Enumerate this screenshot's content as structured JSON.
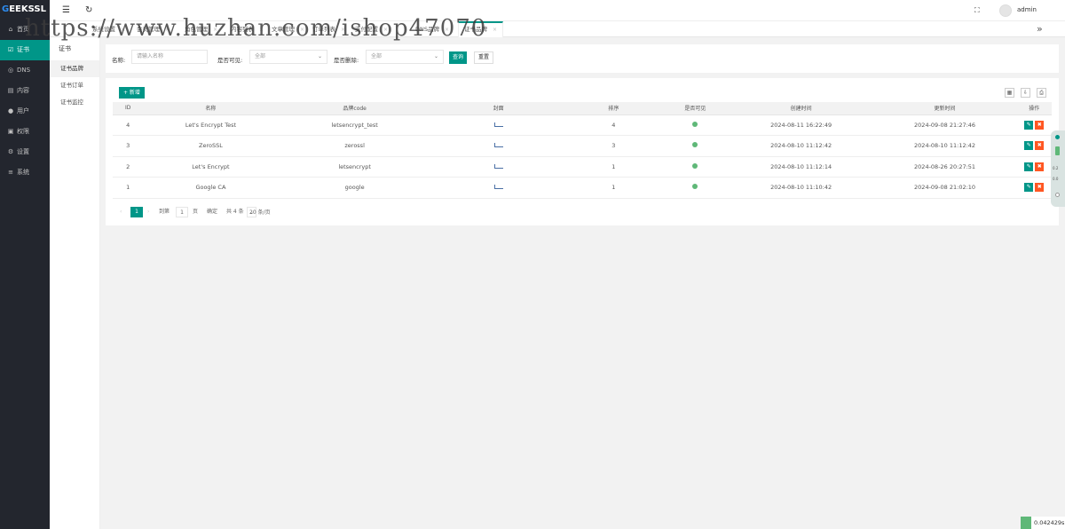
{
  "sidebar": {
    "logo_blue": "G",
    "logo_rest": "EEKSSL",
    "items": [
      {
        "icon": "home-icon",
        "glyph": "⌂",
        "label": "首页"
      },
      {
        "icon": "certificate-icon",
        "glyph": "☑",
        "label": "证书"
      },
      {
        "icon": "globe-icon",
        "glyph": "◎",
        "label": "DNS"
      },
      {
        "icon": "document-icon",
        "glyph": "▤",
        "label": "内容"
      },
      {
        "icon": "user-icon",
        "glyph": "●",
        "label": "用户"
      },
      {
        "icon": "lock-icon",
        "glyph": "▣",
        "label": "权限"
      },
      {
        "icon": "gear-icon",
        "glyph": "⚙",
        "label": "设置"
      },
      {
        "icon": "system-icon",
        "glyph": "≡",
        "label": "系统"
      }
    ],
    "active_color": "#009688"
  },
  "topbar": {
    "menu_glyph": "☰",
    "refresh_glyph": "↻",
    "fullscreen_glyph": "⛶",
    "user": "admin"
  },
  "tabs": {
    "items": [
      {
        "label": "系统设置"
      },
      {
        "label": "会员管理"
      },
      {
        "label": "角色管理"
      },
      {
        "label": "内容列表"
      },
      {
        "label": "文章管理"
      },
      {
        "label": "订单列表"
      },
      {
        "label": "支付配置"
      },
      {
        "label": "DNS品牌"
      },
      {
        "label": "证书品牌"
      }
    ],
    "more_glyph": "»",
    "close_glyph": "×"
  },
  "subnav": {
    "head": "证书",
    "items": [
      {
        "label": "证书品牌"
      },
      {
        "label": "证书订单"
      },
      {
        "label": "证书监控"
      }
    ]
  },
  "search": {
    "name_label": "名称:",
    "name_placeholder": "请输入名称",
    "visible_label": "是否可见:",
    "visible_value": "全部",
    "deleted_label": "是否删除:",
    "deleted_value": "全部",
    "query_label": "查询",
    "reset_label": "重置"
  },
  "toolbar": {
    "add_label": "+ 新增",
    "tools": [
      "▦",
      "⇩",
      "⎙"
    ]
  },
  "table": {
    "columns": [
      "ID",
      "名称",
      "品牌code",
      "封面",
      "排序",
      "是否可见",
      "创建时间",
      "更新时间",
      "操作"
    ],
    "rows": [
      {
        "id": "4",
        "name": "Let's Encrypt Test",
        "code": "letsencrypt_test",
        "sort": "4",
        "created": "2024-08-11 16:22:49",
        "updated": "2024-09-08 21:27:46"
      },
      {
        "id": "3",
        "name": "ZeroSSL",
        "code": "zerossl",
        "sort": "3",
        "created": "2024-08-10 11:12:42",
        "updated": "2024-08-10 11:12:42"
      },
      {
        "id": "2",
        "name": "Let's Encrypt",
        "code": "letsencrypt",
        "sort": "1",
        "created": "2024-08-10 11:12:14",
        "updated": "2024-08-26 20:27:51"
      },
      {
        "id": "1",
        "name": "Google CA",
        "code": "google",
        "sort": "1",
        "created": "2024-08-10 11:10:42",
        "updated": "2024-09-08 21:02:10"
      }
    ]
  },
  "pager": {
    "prev": "‹",
    "current": "1",
    "next": "›",
    "goto": "到第",
    "goto_value": "1",
    "page_unit": "页",
    "confirm": "确定",
    "total": "共 4 条",
    "per_page": "20 条/页"
  },
  "float_panel": {
    "a": "0.2",
    "b": "0.0"
  },
  "timer": "0.042429s",
  "watermark": "https://www.huzhan.com/ishop47070"
}
